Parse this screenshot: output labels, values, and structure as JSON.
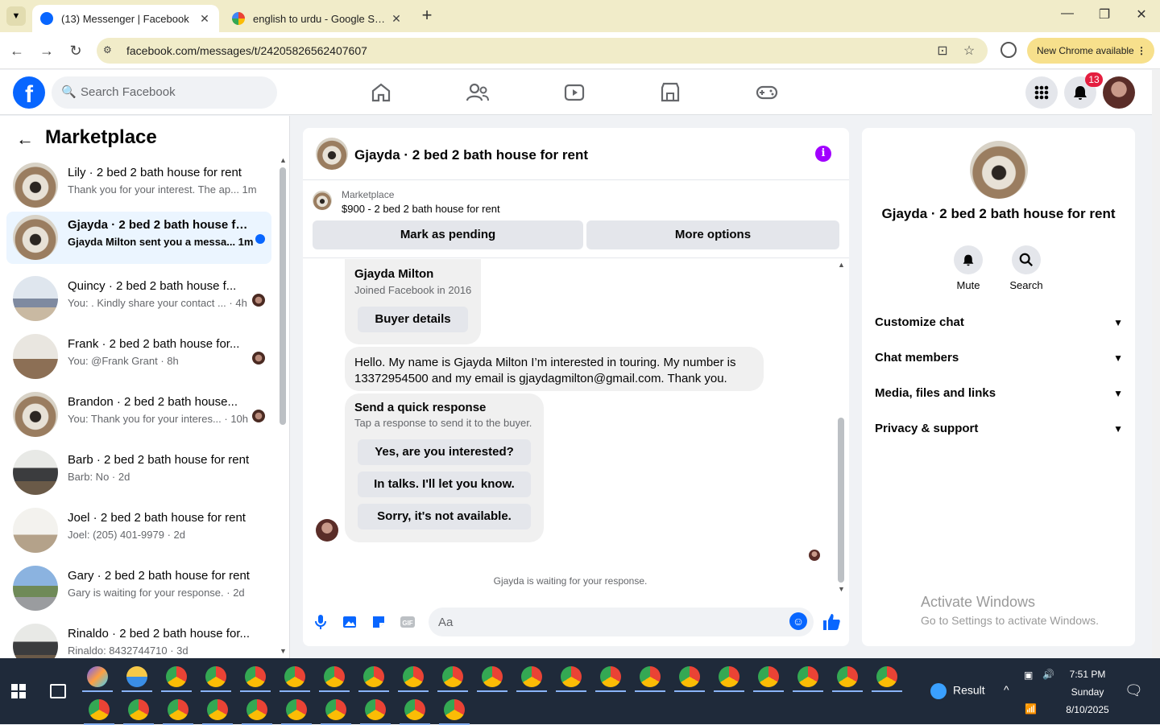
{
  "browser": {
    "tabs": [
      {
        "title": "(13) Messenger | Facebook",
        "active": true
      },
      {
        "title": "english to urdu - Google Search",
        "active": false
      }
    ],
    "url": "facebook.com/messages/t/24205826562407607",
    "new_chrome_label": "New Chrome available",
    "accent": "#f1ecc9"
  },
  "fb": {
    "search_placeholder": "Search Facebook",
    "notification_count": "13",
    "brand_color": "#0866ff"
  },
  "sidebar": {
    "title": "Marketplace",
    "conversations": [
      {
        "name": "Lily · 2 bed 2 bath house for rent",
        "snippet": "Thank you for your interest. The ap... 1m"
      },
      {
        "name": "Gjayda · 2 bed 2 bath house fo...",
        "snippet": "Gjayda Milton sent you a messa... 1m",
        "unread": true
      },
      {
        "name": "Quincy · 2 bed 2 bath house f...",
        "snippet": "You: . Kindly share your contact ... · 4h"
      },
      {
        "name": "Frank · 2 bed 2 bath house for...",
        "snippet": "You: @Frank Grant · 8h"
      },
      {
        "name": "Brandon · 2 bed 2 bath house...",
        "snippet": "You: Thank you for your interes... · 10h"
      },
      {
        "name": "Barb · 2 bed 2 bath house for rent",
        "snippet": "Barb: No · 2d"
      },
      {
        "name": "Joel · 2 bed 2 bath house for rent",
        "snippet": "Joel: (205) 401-9979 · 2d"
      },
      {
        "name": "Gary · 2 bed 2 bath house for rent",
        "snippet": "Gary is waiting for your response. · 2d"
      },
      {
        "name": "Rinaldo · 2 bed 2 bath house for...",
        "snippet": "Rinaldo: 8432744710 · 3d"
      }
    ]
  },
  "chat": {
    "title": "Gjayda · 2 bed 2 bath house for rent",
    "listing_source": "Marketplace",
    "listing_price": "$900 - 2 bed 2 bath house for rent",
    "mark_pending": "Mark as pending",
    "more_options": "More options",
    "profile_name": "Gjayda Milton",
    "profile_joined": "Joined Facebook in 2016",
    "buyer_details": "Buyer details",
    "message": "Hello. My name is Gjayda Milton I’m interested in touring. My number is 13372954500 and my email is gjaydagmilton@gmail.com. Thank you.",
    "quick_title": "Send a quick response",
    "quick_sub": "Tap a response to send it to the buyer.",
    "quick_options": [
      "Yes, are you interested?",
      "In talks. I'll let you know.",
      "Sorry, it's not available."
    ],
    "waiting": "Gjayda is waiting for your response.",
    "composer_placeholder": "Aa"
  },
  "info": {
    "title": "Gjayda · 2 bed 2 bath house for rent",
    "actions": [
      "Mute",
      "Search"
    ],
    "sections": [
      "Customize chat",
      "Chat members",
      "Media, files and links",
      "Privacy & support"
    ]
  },
  "watermark": {
    "line1": "Activate Windows",
    "line2": "Go to Settings to activate Windows."
  },
  "taskbar": {
    "result_label": "Result",
    "time": "7:51 PM",
    "day": "Sunday",
    "date": "8/10/2025"
  }
}
